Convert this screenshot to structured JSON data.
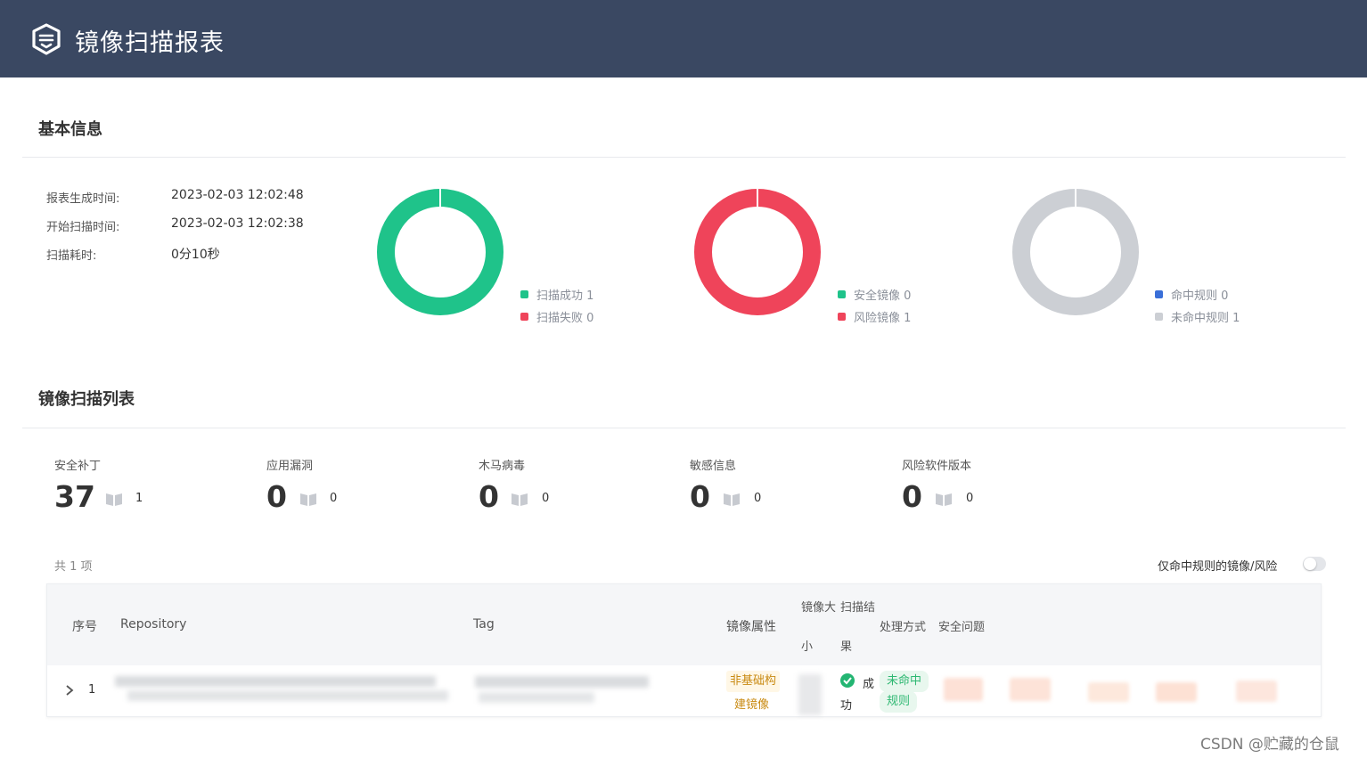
{
  "header": {
    "title": "镜像扫描报表",
    "logo_icon": "shield-logo-icon"
  },
  "basic_info": {
    "section_title": "基本信息",
    "fields": [
      {
        "label": "报表生成时间:",
        "value": "2023-02-03 12:02:48"
      },
      {
        "label": "开始扫描时间:",
        "value": "2023-02-03 12:02:38"
      },
      {
        "label": "扫描耗时:",
        "value": "0分10秒"
      }
    ]
  },
  "donuts": [
    {
      "legend": [
        {
          "label": "扫描成功 1",
          "color": "#1fc38a"
        },
        {
          "label": "扫描失败 0",
          "color": "#ef445a"
        }
      ],
      "ring_color": "#1fc38a"
    },
    {
      "legend": [
        {
          "label": "安全镜像 0",
          "color": "#1fc38a"
        },
        {
          "label": "风险镜像 1",
          "color": "#ef445a"
        }
      ],
      "ring_color": "#ef445a"
    },
    {
      "legend": [
        {
          "label": "命中规则 0",
          "color": "#3a6fd8"
        },
        {
          "label": "未命中规则 1",
          "color": "#cccfd4"
        }
      ],
      "ring_color": "#cccfd4"
    }
  ],
  "scan_list": {
    "section_title": "镜像扫描列表",
    "stats": [
      {
        "label": "安全补丁",
        "value": "37",
        "sub": "1"
      },
      {
        "label": "应用漏洞",
        "value": "0",
        "sub": "0"
      },
      {
        "label": "木马病毒",
        "value": "0",
        "sub": "0"
      },
      {
        "label": "敏感信息",
        "value": "0",
        "sub": "0"
      },
      {
        "label": "风险软件版本",
        "value": "0",
        "sub": "0"
      }
    ],
    "total": "共 1 项",
    "toggle_label": "仅命中规则的镜像/风险",
    "toggle_on": false,
    "columns": {
      "index": "序号",
      "repository": "Repository",
      "tag": "Tag",
      "attribute": "镜像属性",
      "size_line1": "镜像大",
      "size_line2": "小",
      "result_line1": "扫描结",
      "result_line2": "果",
      "handling": "处理方式",
      "issues": "安全问题"
    },
    "rows": [
      {
        "index": "1",
        "attribute_line1": "非基础构",
        "attribute_line2": "建镜像",
        "result_line1": "成",
        "result_line2": "功",
        "handling_line1": "未命中",
        "handling_line2": "规则"
      }
    ]
  },
  "watermark": "CSDN @贮藏的仓鼠"
}
